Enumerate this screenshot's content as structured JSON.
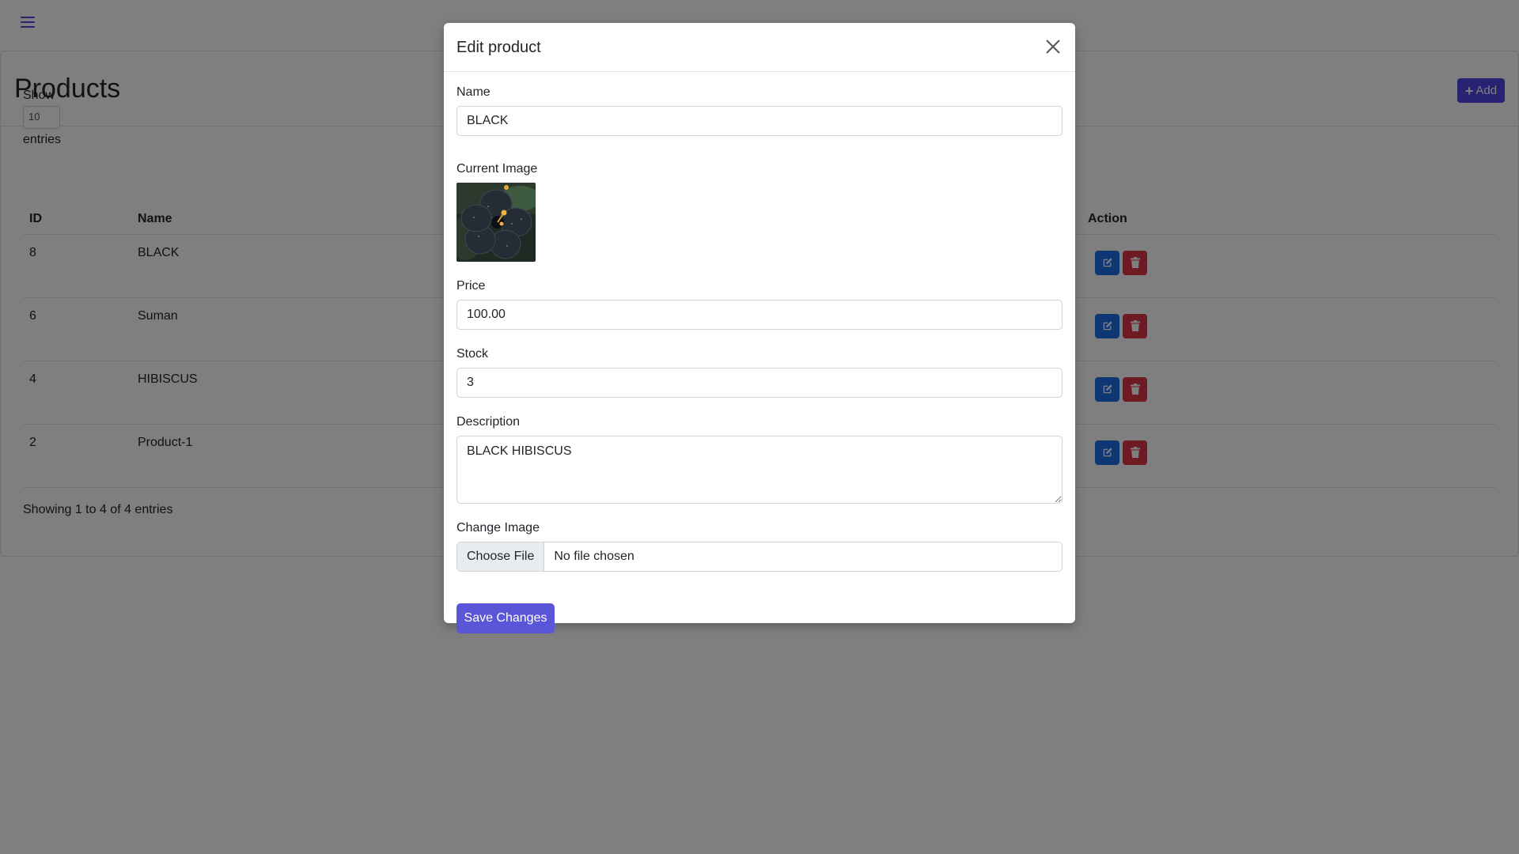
{
  "page": {
    "title": "Products",
    "add_label": "Add",
    "length": {
      "show_label": "Show",
      "value": "10",
      "entries_label": "entries"
    },
    "table": {
      "headers": {
        "id": "ID",
        "name": "Name",
        "action": "Action"
      },
      "rows": [
        {
          "id": "8",
          "name": "BLACK"
        },
        {
          "id": "6",
          "name": "Suman"
        },
        {
          "id": "4",
          "name": "HIBISCUS"
        },
        {
          "id": "2",
          "name": "Product-1"
        }
      ]
    },
    "info": "Showing 1 to 4 of 4 entries"
  },
  "modal": {
    "title": "Edit product",
    "name_label": "Name",
    "name_value": "BLACK",
    "current_image_label": "Current Image",
    "price_label": "Price",
    "price_value": "100.00",
    "stock_label": "Stock",
    "stock_value": "3",
    "description_label": "Description",
    "description_value": "BLACK HIBISCUS",
    "change_image_label": "Change Image",
    "choose_file_label": "Choose File",
    "no_file_label": "No file chosen",
    "save_label": "Save Changes"
  },
  "colors": {
    "accent": "#4f46e5",
    "edit": "#1d6ee6",
    "delete": "#dc3545"
  }
}
